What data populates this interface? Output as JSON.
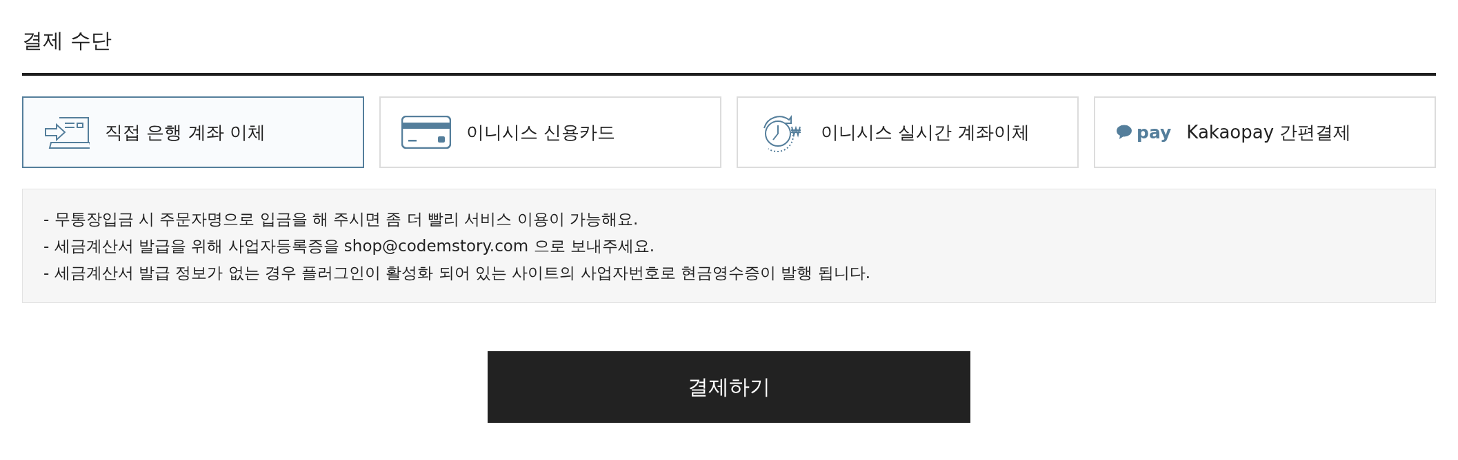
{
  "section_title": "결제 수단",
  "methods": [
    {
      "kind": "bank",
      "label": "직접 은행 계좌 이체",
      "selected": true
    },
    {
      "kind": "card",
      "label": "이니시스 신용카드",
      "selected": false
    },
    {
      "kind": "realtime",
      "label": "이니시스 실시간 계좌이체",
      "selected": false
    },
    {
      "kind": "kakao",
      "badge": "pay",
      "label": "Kakaopay 간편결제",
      "selected": false
    }
  ],
  "notices": [
    "- 무통장입금 시 주문자명으로 입금을 해 주시면 좀 더 빨리 서비스 이용이 가능해요.",
    "- 세금계산서 발급을 위해 사업자등록증을 shop@codemstory.com 으로 보내주세요.",
    "- 세금계산서 발급 정보가 없는 경우 플러그인이 활성화 되어 있는 사이트의 사업자번호로 현금영수증이 발행 됩니다."
  ],
  "submit_button": "결제하기"
}
